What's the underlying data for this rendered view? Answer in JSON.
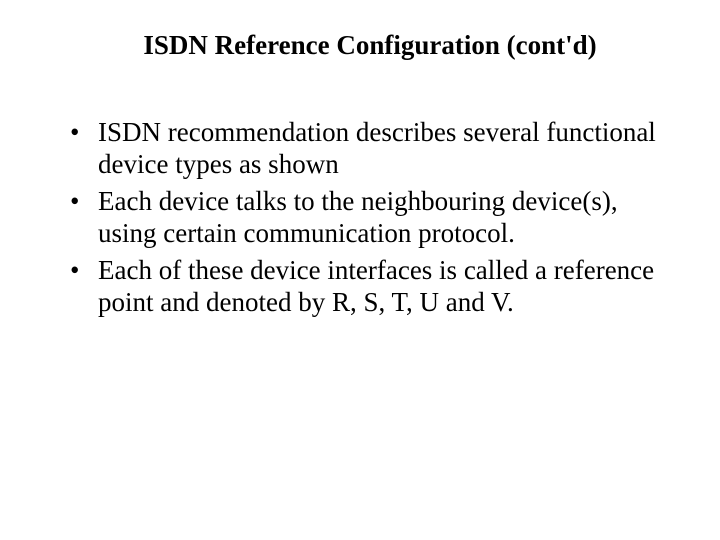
{
  "title": "ISDN Reference Configuration (cont'd)",
  "bullets": [
    "ISDN recommendation describes several functional device types as shown",
    "Each device talks to the neighbouring device(s), using certain communication protocol.",
    "Each of these device interfaces is called a reference point and denoted by R, S, T, U and V."
  ]
}
